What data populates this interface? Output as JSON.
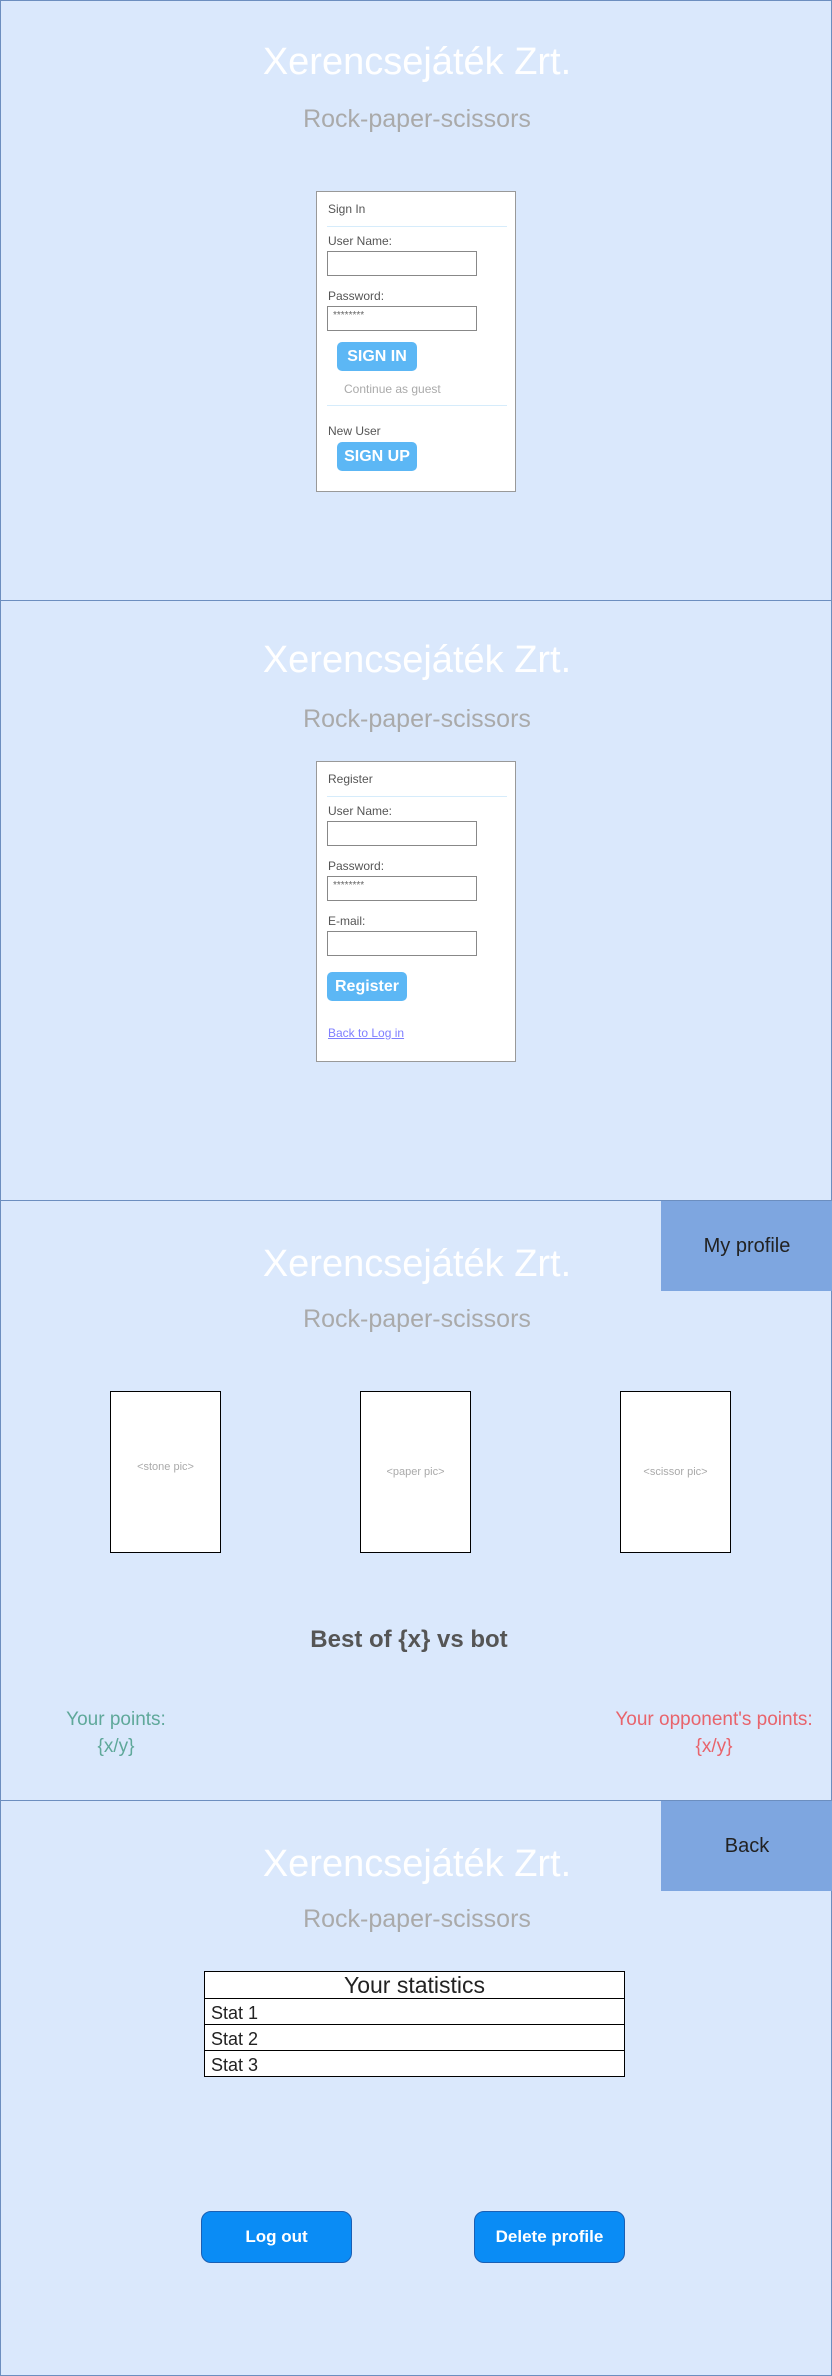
{
  "app": {
    "title": "Xerencsejáték Zrt.",
    "subtitle": "Rock-paper-scissors"
  },
  "signin": {
    "title": "Sign In",
    "username_label": "User Name:",
    "username_value": "",
    "password_label": "Password:",
    "password_value": "********",
    "signin_button": "SIGN IN",
    "guest_link": "Continue as guest",
    "new_user_label": "New User",
    "signup_button": "SIGN UP"
  },
  "register": {
    "title": "Register",
    "username_label": "User Name:",
    "username_value": "",
    "password_label": "Password:",
    "password_value": "********",
    "email_label": "E-mail:",
    "email_value": "",
    "register_button": "Register",
    "back_link": "Back to Log in"
  },
  "game": {
    "profile_button": "My profile",
    "choices": [
      "<stone pic>",
      "<paper pic>",
      "<scissor pic>"
    ],
    "best_of": "Best of {x} vs bot",
    "your_points_label": "Your points:",
    "your_points_value": "{x/y}",
    "opponent_points_label": "Your opponent's points:",
    "opponent_points_value": "{x/y}",
    "colors": {
      "your_points": "#5fa89a",
      "opponent_points": "#e8646c"
    }
  },
  "profile": {
    "back_button": "Back",
    "stats_title": "Your statistics",
    "stats": [
      "Stat 1",
      "Stat 2",
      "Stat 3"
    ],
    "logout_button": "Log out",
    "delete_button": "Delete profile"
  }
}
